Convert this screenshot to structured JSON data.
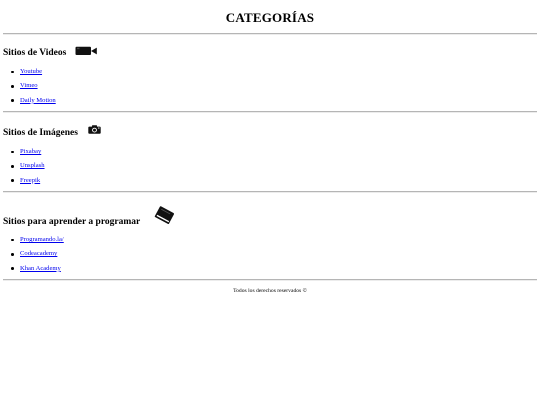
{
  "page": {
    "title": "CATEGORÍAS"
  },
  "sections": [
    {
      "heading": "Sitios de Videos",
      "icon": "video-camera-icon",
      "links": [
        "Youtube",
        "Vimeo",
        "Daily Motion"
      ]
    },
    {
      "heading": "Sitios de Imágenes",
      "icon": "camera-icon",
      "links": [
        "Pixabay",
        "Unsplash",
        "Freepik"
      ]
    },
    {
      "heading": "Sitios para aprender a programar",
      "icon": "book-icon",
      "links": [
        "Programando.la/",
        "Codeacademy",
        "Khan Academy"
      ]
    }
  ],
  "footer": {
    "text": "Todos los derechos reservados ©"
  },
  "colors": {
    "link": "#0000ee",
    "text": "#000000",
    "divider": "#b5b5b5",
    "background": "#ffffff"
  }
}
